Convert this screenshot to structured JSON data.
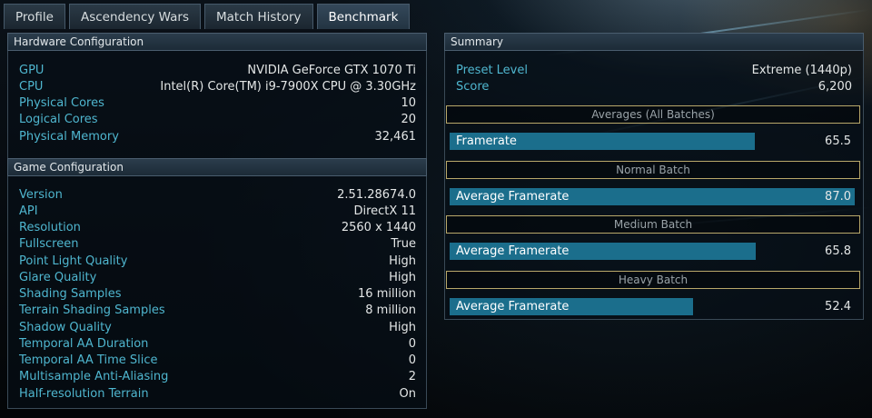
{
  "tabs": [
    "Profile",
    "Ascendency Wars",
    "Match History",
    "Benchmark"
  ],
  "hardware": {
    "header": "Hardware Configuration",
    "rows": [
      {
        "label": "GPU",
        "value": "NVIDIA GeForce GTX 1070 Ti"
      },
      {
        "label": "CPU",
        "value": "Intel(R) Core(TM) i9-7900X CPU @ 3.30GHz"
      },
      {
        "label": "Physical Cores",
        "value": "10"
      },
      {
        "label": "Logical Cores",
        "value": "20"
      },
      {
        "label": "Physical Memory",
        "value": "32,461"
      }
    ]
  },
  "game": {
    "header": "Game Configuration",
    "rows": [
      {
        "label": "Version",
        "value": "2.51.28674.0"
      },
      {
        "label": "API",
        "value": "DirectX 11"
      },
      {
        "label": "Resolution",
        "value": "2560 x 1440"
      },
      {
        "label": "Fullscreen",
        "value": "True"
      },
      {
        "label": "Point Light Quality",
        "value": "High"
      },
      {
        "label": "Glare Quality",
        "value": "High"
      },
      {
        "label": "Shading Samples",
        "value": "16 million"
      },
      {
        "label": "Terrain Shading Samples",
        "value": "8 million"
      },
      {
        "label": "Shadow Quality",
        "value": "High"
      },
      {
        "label": "Temporal AA Duration",
        "value": "0"
      },
      {
        "label": "Temporal AA Time Slice",
        "value": "0"
      },
      {
        "label": "Multisample Anti-Aliasing",
        "value": "2"
      },
      {
        "label": "Half-resolution Terrain",
        "value": "On"
      }
    ]
  },
  "summary": {
    "header": "Summary",
    "preset_label": "Preset Level",
    "preset_value": "Extreme (1440p)",
    "score_label": "Score",
    "score_value": "6,200",
    "sections": [
      {
        "title": "Averages (All Batches)",
        "bar_label": "Framerate",
        "value": "65.5",
        "fill": 0.753
      },
      {
        "title": "Normal Batch",
        "bar_label": "Average Framerate",
        "value": "87.0",
        "fill": 1.0
      },
      {
        "title": "Medium Batch",
        "bar_label": "Average Framerate",
        "value": "65.8",
        "fill": 0.756
      },
      {
        "title": "Heavy Batch",
        "bar_label": "Average Framerate",
        "value": "52.4",
        "fill": 0.602
      }
    ]
  }
}
